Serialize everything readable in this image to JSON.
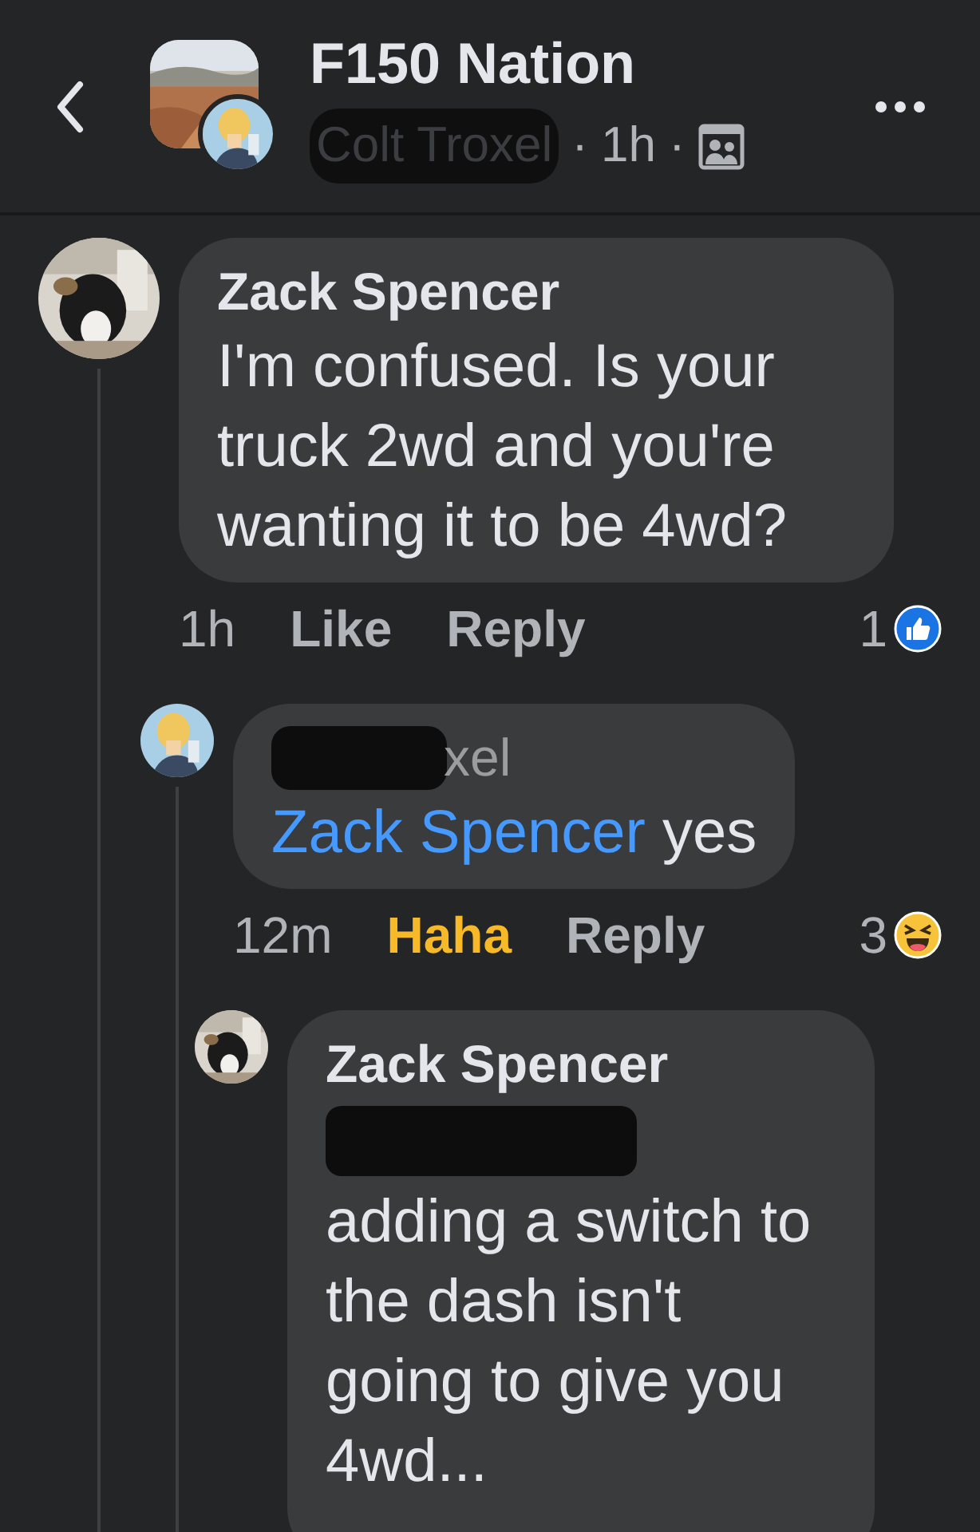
{
  "header": {
    "title": "F150 Nation",
    "author": "Colt Troxel",
    "separator_1": "·",
    "time": "1h",
    "separator_2": "·"
  },
  "comments": [
    {
      "author": "Zack Spencer",
      "text": "I'm confused. Is your truck 2wd and you're wanting it to be 4wd?",
      "time": "1h",
      "reaction_button": {
        "label": "Like",
        "active": false
      },
      "reply_label": "Reply",
      "reaction": {
        "kind": "like",
        "count": "1"
      },
      "children": [
        {
          "author": "xel",
          "author_redacted": true,
          "mention": "Zack Spencer",
          "text": "yes",
          "time": "12m",
          "reaction_button": {
            "label": "Haha",
            "active": true
          },
          "reply_label": "Reply",
          "reaction": {
            "kind": "haha",
            "count": "3"
          },
          "children": [
            {
              "author": "Zack Spencer",
              "text_redacted": true,
              "text": "adding a switch to the dash isn't going to give you 4wd..."
            }
          ]
        }
      ]
    }
  ]
}
